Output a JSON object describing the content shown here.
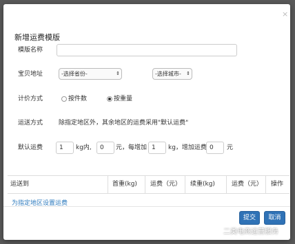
{
  "dialog": {
    "title": "新增运费模版",
    "close_icon": "×"
  },
  "form": {
    "template_name": {
      "label": "模版名称",
      "value": "",
      "placeholder": ""
    },
    "address": {
      "label": "宝贝地址",
      "province_select": "-选择省份-",
      "city_select": "-选择城市-",
      "chevron": "⇕"
    },
    "pricing": {
      "label": "计价方式",
      "options": [
        {
          "label": "按件数",
          "checked": false
        },
        {
          "label": "按重量",
          "checked": true
        }
      ]
    },
    "shipping": {
      "label": "运送方式",
      "description": "除指定地区外，其余地区的运费采用\"默认运费\""
    },
    "default_fee": {
      "label": "默认运费",
      "first_weight": "1",
      "first_weight_unit": "kg内,",
      "first_fee": "0",
      "first_fee_unit": "元，每增加",
      "extra_weight": "1",
      "extra_weight_unit": "kg，增加运费",
      "extra_fee": "0",
      "extra_fee_unit": "元"
    }
  },
  "table": {
    "columns": [
      "运送到",
      "首重(kg)",
      "运费（元）",
      "续重(kg)",
      "运费（元）",
      "操作"
    ]
  },
  "specific_region_link": "为指定地区设置运费",
  "buttons": {
    "submit": "提交",
    "cancel": "取消"
  },
  "watermark": "二类电商运营服务"
}
